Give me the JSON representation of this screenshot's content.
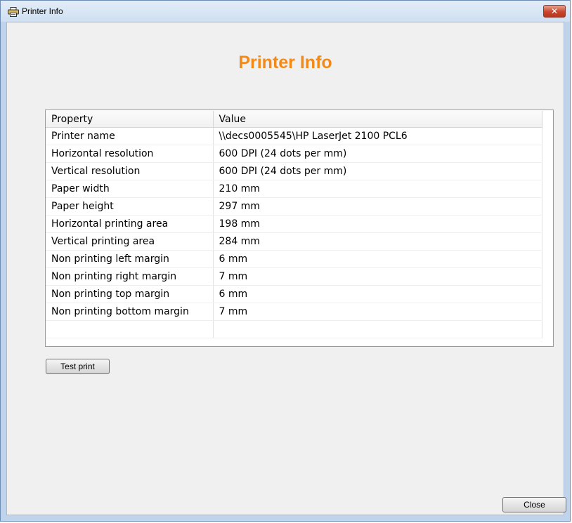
{
  "window": {
    "title": "Printer Info",
    "icon": "printer-icon",
    "close_glyph": "✕"
  },
  "heading": "Printer Info",
  "table": {
    "columns": [
      "Property",
      "Value"
    ],
    "rows": [
      {
        "property": "Printer name",
        "value": "\\\\decs0005545\\HP LaserJet 2100 PCL6"
      },
      {
        "property": "Horizontal resolution",
        "value": "600 DPI  (24 dots per mm)"
      },
      {
        "property": "Vertical resolution",
        "value": "600 DPI  (24 dots per mm)"
      },
      {
        "property": "Paper width",
        "value": "210  mm"
      },
      {
        "property": "Paper height",
        "value": "297  mm"
      },
      {
        "property": "Horizontal printing area",
        "value": "198  mm"
      },
      {
        "property": "Vertical printing area",
        "value": "284  mm"
      },
      {
        "property": "Non printing left margin",
        "value": "6  mm"
      },
      {
        "property": "Non printing right margin",
        "value": "7  mm"
      },
      {
        "property": "Non printing top margin",
        "value": "6  mm"
      },
      {
        "property": "Non printing bottom margin",
        "value": "7  mm"
      }
    ]
  },
  "buttons": {
    "test_print": "Test print",
    "close": "Close"
  },
  "colors": {
    "heading": "#f28a1a",
    "close_button": "#c7462d",
    "frame": "#bfd3ea"
  }
}
